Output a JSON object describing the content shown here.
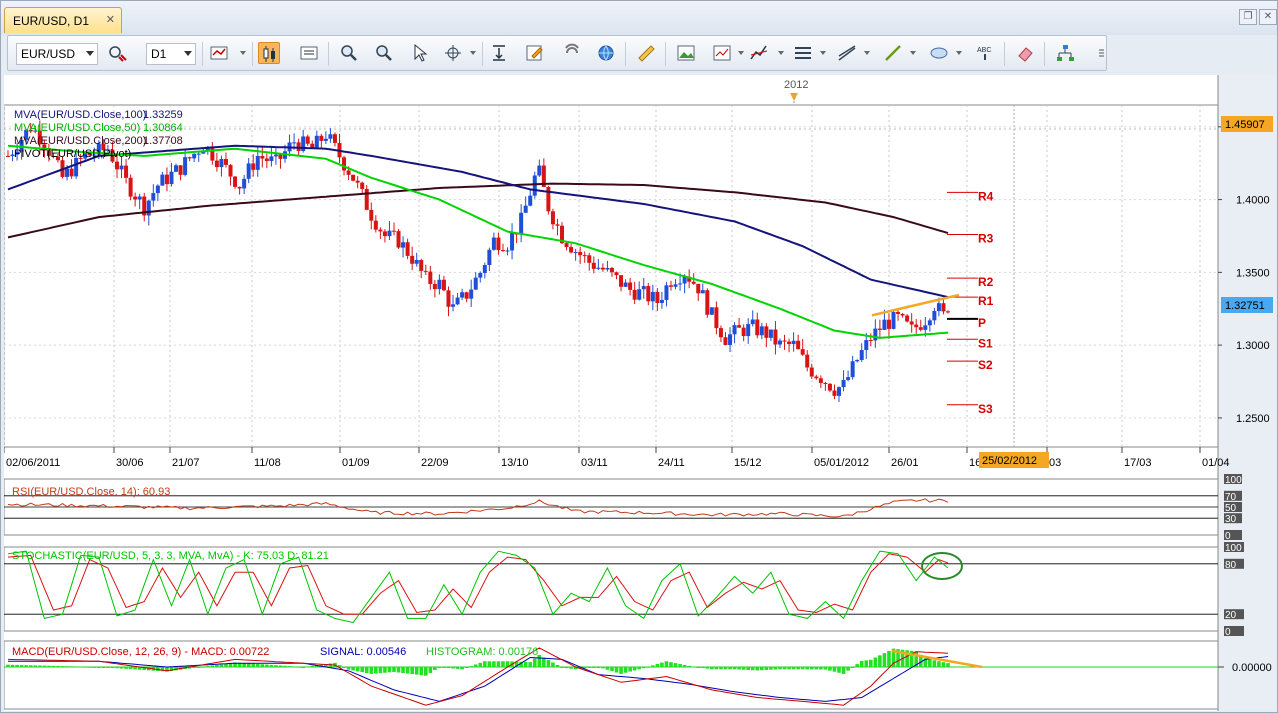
{
  "window": {
    "tab_title": "EUR/USD, D1",
    "close_glyph": "✕"
  },
  "toolbar": {
    "symbol": "EUR/USD",
    "timeframe": "D1",
    "icons": [
      "compare-icon",
      "bar-type-icon",
      "candlestick-icon",
      "heikin-icon",
      "zoom-in-icon",
      "zoom-out-icon",
      "cursor-icon",
      "crosshair-icon",
      "scroll-to-end-icon",
      "edit-icon",
      "magnet-icon",
      "globe-icon",
      "ruler-icon",
      "screenshot-icon",
      "template-icon",
      "indicators-icon",
      "lines-icon",
      "trendline-icon",
      "pen-icon",
      "shapes-icon",
      "text-icon",
      "eraser-icon",
      "objects-tree-icon"
    ]
  },
  "colors": {
    "bull": "#1f4fd8",
    "bear": "#d81414",
    "ma100": "#14147a",
    "ma50": "#00d400",
    "ma200": "#3a0a1a",
    "pivot": "#d80000",
    "accent": "#f5a623",
    "rsi": "#c23a1a",
    "stoch_k": "#00c400",
    "stoch_d": "#d81414",
    "macd": "#c80000",
    "signal": "#0000b4",
    "hist": "#22e022"
  },
  "chart_data": {
    "type": "candlestick",
    "symbol": "EUR/USD",
    "timeframe": "D1",
    "year_marker": "2012",
    "y_ticks": [
      "1.4500",
      "1.4000",
      "1.3500",
      "1.3000",
      "1.2500"
    ],
    "ylim": [
      1.23,
      1.465
    ],
    "x_tick_labels": [
      "02/06/2011",
      "30/06",
      "21/07",
      "11/08",
      "01/09",
      "22/09",
      "13/10",
      "03/11",
      "24/11",
      "15/12",
      "05/01/2012",
      "26/01",
      "16/02",
      "03",
      "17/03",
      "01/04"
    ],
    "cursor_date": "25/02/2012",
    "last_price": "1.32751",
    "high_marker": "1.45907",
    "close_anchors": [
      [
        0,
        1.43
      ],
      [
        5,
        1.45
      ],
      [
        8,
        1.44
      ],
      [
        12,
        1.415
      ],
      [
        17,
        1.43
      ],
      [
        22,
        1.435
      ],
      [
        26,
        1.412
      ],
      [
        30,
        1.395
      ],
      [
        33,
        1.41
      ],
      [
        38,
        1.422
      ],
      [
        43,
        1.438
      ],
      [
        47,
        1.425
      ],
      [
        51,
        1.41
      ],
      [
        55,
        1.43
      ],
      [
        59,
        1.425
      ],
      [
        63,
        1.44
      ],
      [
        67,
        1.435
      ],
      [
        70,
        1.445
      ],
      [
        73,
        1.43
      ],
      [
        76,
        1.415
      ],
      [
        80,
        1.39
      ],
      [
        83,
        1.375
      ],
      [
        86,
        1.372
      ],
      [
        89,
        1.36
      ],
      [
        92,
        1.345
      ],
      [
        95,
        1.342
      ],
      [
        98,
        1.325
      ],
      [
        101,
        1.335
      ],
      [
        104,
        1.35
      ],
      [
        107,
        1.372
      ],
      [
        110,
        1.37
      ],
      [
        113,
        1.385
      ],
      [
        116,
        1.415
      ],
      [
        117,
        1.418
      ],
      [
        119,
        1.395
      ],
      [
        122,
        1.375
      ],
      [
        125,
        1.365
      ],
      [
        128,
        1.357
      ],
      [
        131,
        1.352
      ],
      [
        134,
        1.345
      ],
      [
        137,
        1.338
      ],
      [
        140,
        1.335
      ],
      [
        143,
        1.33
      ],
      [
        146,
        1.345
      ],
      [
        149,
        1.35
      ],
      [
        152,
        1.34
      ],
      [
        155,
        1.32
      ],
      [
        158,
        1.305
      ],
      [
        161,
        1.31
      ],
      [
        164,
        1.312
      ],
      [
        167,
        1.308
      ],
      [
        170,
        1.3
      ],
      [
        173,
        1.3
      ],
      [
        176,
        1.285
      ],
      [
        179,
        1.278
      ],
      [
        182,
        1.27
      ],
      [
        184,
        1.272
      ],
      [
        187,
        1.29
      ],
      [
        190,
        1.305
      ],
      [
        193,
        1.315
      ],
      [
        196,
        1.318
      ],
      [
        199,
        1.31
      ],
      [
        202,
        1.318
      ],
      [
        204,
        1.328
      ],
      [
        206,
        1.32
      ],
      [
        207,
        1.3275
      ]
    ],
    "series": [
      {
        "name": "MVA(EUR/USD.Close,100)",
        "last": "1.33259"
      },
      {
        "name": "MVA(EUR/USD.Close,50)",
        "last": "1.30864"
      },
      {
        "name": "MVA(EUR/USD.Close,200)",
        "last": "1.37708"
      },
      {
        "name": "PIVOT(EUR/USD,Pivot)",
        "last": ""
      }
    ],
    "ma100_anchors": [
      [
        0,
        1.407
      ],
      [
        20,
        1.43
      ],
      [
        50,
        1.437
      ],
      [
        70,
        1.435
      ],
      [
        80,
        1.43
      ],
      [
        100,
        1.419
      ],
      [
        115,
        1.407
      ],
      [
        140,
        1.397
      ],
      [
        160,
        1.385
      ],
      [
        175,
        1.368
      ],
      [
        190,
        1.345
      ],
      [
        207,
        1.333
      ]
    ],
    "ma50_anchors": [
      [
        0,
        1.437
      ],
      [
        15,
        1.433
      ],
      [
        30,
        1.43
      ],
      [
        50,
        1.435
      ],
      [
        70,
        1.428
      ],
      [
        80,
        1.415
      ],
      [
        95,
        1.4
      ],
      [
        110,
        1.378
      ],
      [
        125,
        1.37
      ],
      [
        140,
        1.355
      ],
      [
        155,
        1.342
      ],
      [
        170,
        1.325
      ],
      [
        182,
        1.31
      ],
      [
        192,
        1.305
      ],
      [
        207,
        1.3086
      ]
    ],
    "ma200_anchors": [
      [
        0,
        1.374
      ],
      [
        20,
        1.388
      ],
      [
        45,
        1.396
      ],
      [
        70,
        1.402
      ],
      [
        95,
        1.408
      ],
      [
        120,
        1.411
      ],
      [
        140,
        1.41
      ],
      [
        160,
        1.405
      ],
      [
        180,
        1.398
      ],
      [
        195,
        1.388
      ],
      [
        207,
        1.377
      ]
    ],
    "pivots": [
      {
        "label": "R4",
        "value": 1.405
      },
      {
        "label": "R3",
        "value": 1.376
      },
      {
        "label": "R2",
        "value": 1.346
      },
      {
        "label": "R1",
        "value": 1.333
      },
      {
        "label": "P",
        "value": 1.318
      },
      {
        "label": "S1",
        "value": 1.304
      },
      {
        "label": "S2",
        "value": 1.289
      },
      {
        "label": "S3",
        "value": 1.259
      }
    ],
    "rsi": {
      "label": "RSI(EUR/USD.Close, 14): 60.93",
      "levels": [
        "100",
        "70",
        "50",
        "30",
        "0"
      ],
      "anchors": [
        [
          0,
          55
        ],
        [
          20,
          52
        ],
        [
          40,
          48
        ],
        [
          60,
          52
        ],
        [
          70,
          56
        ],
        [
          80,
          40
        ],
        [
          95,
          38
        ],
        [
          110,
          48
        ],
        [
          117,
          60
        ],
        [
          125,
          42
        ],
        [
          140,
          40
        ],
        [
          155,
          36
        ],
        [
          170,
          38
        ],
        [
          184,
          33
        ],
        [
          195,
          58
        ],
        [
          200,
          62
        ],
        [
          207,
          61
        ]
      ]
    },
    "stochastic": {
      "label": "STOCHASTIC(EUR/USD, 5, 3, 3, MVA, MvA) -  K: 75.03  D: 81.21",
      "levels": [
        "100",
        "80",
        "20",
        "0"
      ],
      "k_anchors": [
        [
          0,
          92
        ],
        [
          4,
          95
        ],
        [
          8,
          15
        ],
        [
          12,
          20
        ],
        [
          16,
          90
        ],
        [
          20,
          88
        ],
        [
          24,
          18
        ],
        [
          28,
          25
        ],
        [
          32,
          85
        ],
        [
          36,
          30
        ],
        [
          40,
          85
        ],
        [
          44,
          20
        ],
        [
          48,
          75
        ],
        [
          52,
          85
        ],
        [
          56,
          20
        ],
        [
          60,
          80
        ],
        [
          64,
          88
        ],
        [
          68,
          25
        ],
        [
          72,
          15
        ],
        [
          76,
          10
        ],
        [
          80,
          40
        ],
        [
          84,
          70
        ],
        [
          88,
          15
        ],
        [
          92,
          15
        ],
        [
          96,
          55
        ],
        [
          100,
          20
        ],
        [
          104,
          70
        ],
        [
          108,
          95
        ],
        [
          112,
          90
        ],
        [
          116,
          75
        ],
        [
          120,
          20
        ],
        [
          124,
          45
        ],
        [
          128,
          35
        ],
        [
          132,
          75
        ],
        [
          136,
          30
        ],
        [
          140,
          15
        ],
        [
          144,
          60
        ],
        [
          148,
          80
        ],
        [
          152,
          18
        ],
        [
          156,
          40
        ],
        [
          160,
          65
        ],
        [
          164,
          45
        ],
        [
          168,
          70
        ],
        [
          172,
          20
        ],
        [
          176,
          15
        ],
        [
          180,
          35
        ],
        [
          184,
          15
        ],
        [
          188,
          60
        ],
        [
          192,
          95
        ],
        [
          196,
          92
        ],
        [
          200,
          60
        ],
        [
          204,
          88
        ],
        [
          207,
          75
        ]
      ],
      "d_anchors": [
        [
          0,
          88
        ],
        [
          5,
          90
        ],
        [
          10,
          25
        ],
        [
          14,
          30
        ],
        [
          18,
          85
        ],
        [
          22,
          75
        ],
        [
          26,
          28
        ],
        [
          30,
          35
        ],
        [
          34,
          75
        ],
        [
          38,
          40
        ],
        [
          42,
          70
        ],
        [
          46,
          30
        ],
        [
          50,
          70
        ],
        [
          54,
          70
        ],
        [
          58,
          30
        ],
        [
          62,
          75
        ],
        [
          66,
          78
        ],
        [
          70,
          30
        ],
        [
          74,
          20
        ],
        [
          78,
          20
        ],
        [
          82,
          45
        ],
        [
          86,
          60
        ],
        [
          90,
          22
        ],
        [
          94,
          25
        ],
        [
          98,
          50
        ],
        [
          102,
          28
        ],
        [
          106,
          70
        ],
        [
          110,
          88
        ],
        [
          114,
          85
        ],
        [
          118,
          60
        ],
        [
          122,
          30
        ],
        [
          126,
          40
        ],
        [
          130,
          40
        ],
        [
          134,
          65
        ],
        [
          138,
          35
        ],
        [
          142,
          25
        ],
        [
          146,
          60
        ],
        [
          150,
          70
        ],
        [
          154,
          28
        ],
        [
          158,
          45
        ],
        [
          162,
          58
        ],
        [
          166,
          50
        ],
        [
          170,
          60
        ],
        [
          174,
          25
        ],
        [
          178,
          22
        ],
        [
          182,
          32
        ],
        [
          186,
          25
        ],
        [
          190,
          70
        ],
        [
          194,
          92
        ],
        [
          198,
          88
        ],
        [
          202,
          70
        ],
        [
          205,
          85
        ],
        [
          207,
          81
        ]
      ]
    },
    "macd": {
      "label_prefix": "MACD(EUR/USD.Close, 12, 26, 9) -  MACD: 0.00722",
      "label_signal": "SIGNAL: 0.00546",
      "label_hist": "HISTOGRAM: 0.00176",
      "zero": "0.00000",
      "macd_anchors": [
        [
          0,
          0.004
        ],
        [
          20,
          0.003
        ],
        [
          35,
          -0.002
        ],
        [
          50,
          0.004
        ],
        [
          65,
          0.002
        ],
        [
          72,
          0.001
        ],
        [
          80,
          -0.01
        ],
        [
          92,
          -0.02
        ],
        [
          100,
          -0.015
        ],
        [
          110,
          0.0
        ],
        [
          117,
          0.01
        ],
        [
          125,
          0.0
        ],
        [
          135,
          -0.008
        ],
        [
          145,
          -0.005
        ],
        [
          155,
          -0.012
        ],
        [
          165,
          -0.016
        ],
        [
          175,
          -0.018
        ],
        [
          184,
          -0.02
        ],
        [
          190,
          -0.01
        ],
        [
          195,
          0.002
        ],
        [
          200,
          0.008
        ],
        [
          207,
          0.0072
        ]
      ],
      "signal_anchors": [
        [
          0,
          0.003
        ],
        [
          20,
          0.003
        ],
        [
          35,
          0.0
        ],
        [
          50,
          0.002
        ],
        [
          65,
          0.002
        ],
        [
          75,
          -0.002
        ],
        [
          85,
          -0.012
        ],
        [
          95,
          -0.018
        ],
        [
          105,
          -0.01
        ],
        [
          115,
          0.005
        ],
        [
          122,
          0.004
        ],
        [
          130,
          -0.004
        ],
        [
          140,
          -0.006
        ],
        [
          150,
          -0.009
        ],
        [
          160,
          -0.013
        ],
        [
          170,
          -0.016
        ],
        [
          180,
          -0.018
        ],
        [
          188,
          -0.016
        ],
        [
          195,
          -0.006
        ],
        [
          202,
          0.004
        ],
        [
          207,
          0.0055
        ]
      ]
    }
  }
}
